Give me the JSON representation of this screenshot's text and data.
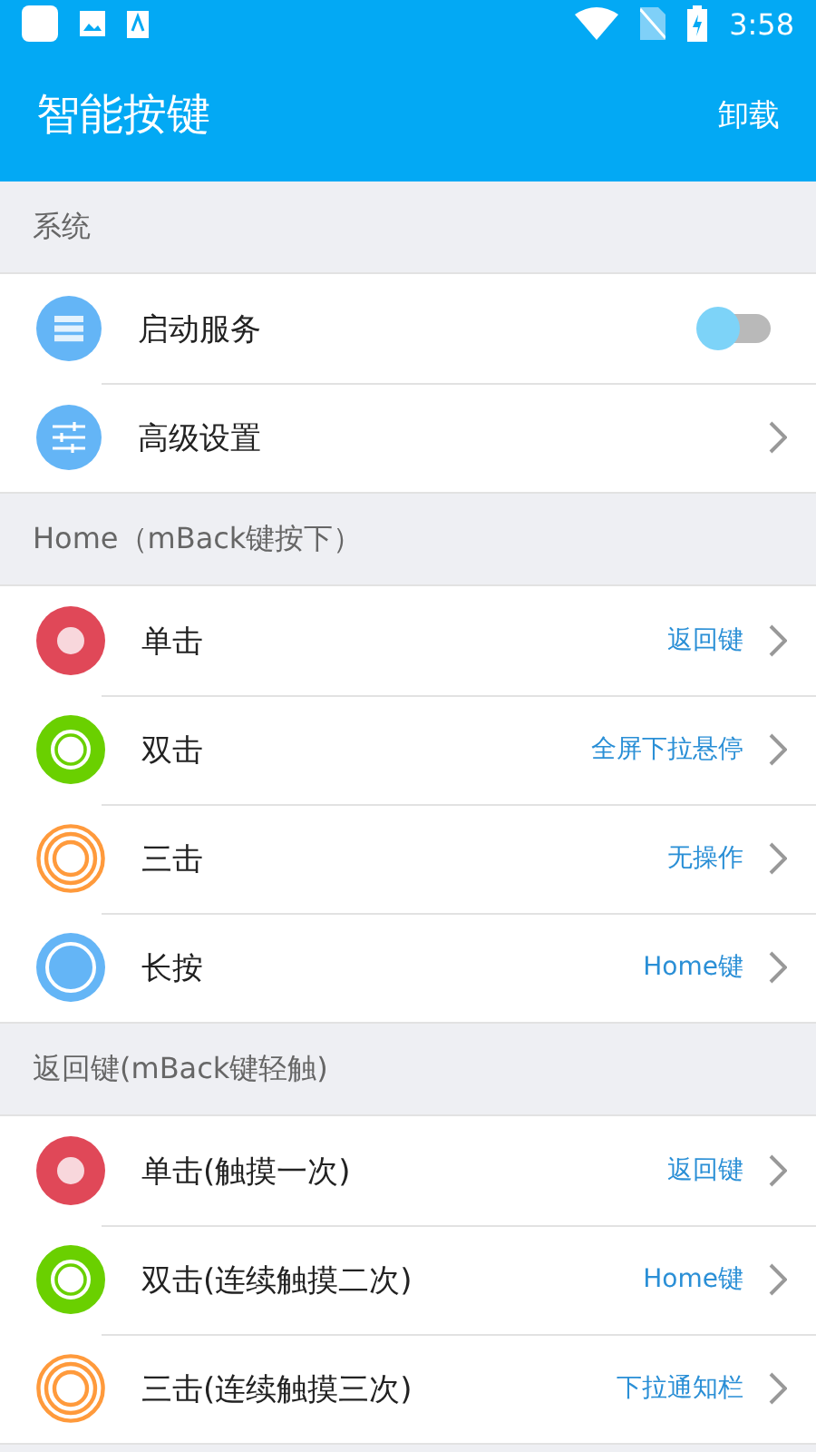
{
  "status_bar": {
    "time": "3:58"
  },
  "app_bar": {
    "title": "智能按键",
    "action": "卸载"
  },
  "sections": [
    {
      "title": "系统",
      "rows": [
        {
          "kind": "switch",
          "label": "启动服务",
          "on": false
        },
        {
          "kind": "link",
          "label": "高级设置"
        }
      ]
    },
    {
      "title": "Home（mBack键按下）",
      "rows": [
        {
          "kind": "link",
          "label": "单击",
          "value": "返回键"
        },
        {
          "kind": "link",
          "label": "双击",
          "value": "全屏下拉悬停"
        },
        {
          "kind": "link",
          "label": "三击",
          "value": "无操作"
        },
        {
          "kind": "link",
          "label": "长按",
          "value": "Home键"
        }
      ]
    },
    {
      "title": "返回键(mBack键轻触)",
      "rows": [
        {
          "kind": "link",
          "label": "单击(触摸一次)",
          "value": "返回键"
        },
        {
          "kind": "link",
          "label": "双击(连续触摸二次)",
          "value": "Home键"
        },
        {
          "kind": "link",
          "label": "三击(连续触摸三次)",
          "value": "下拉通知栏"
        }
      ]
    }
  ]
}
